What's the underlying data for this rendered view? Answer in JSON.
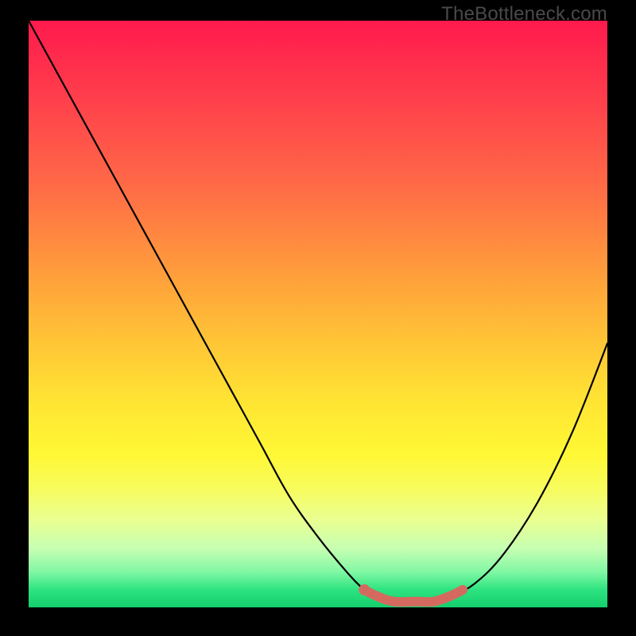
{
  "watermark": "TheBottleneck.com",
  "colors": {
    "frame": "#000000",
    "curve": "#000000",
    "highlight": "#d46a5f",
    "gradient_top": "#ff1a4d",
    "gradient_bottom": "#14cf6e"
  },
  "chart_data": {
    "type": "line",
    "title": "",
    "xlabel": "",
    "ylabel": "",
    "xlim": [
      0,
      100
    ],
    "ylim": [
      0,
      100
    ],
    "grid": false,
    "legend": false,
    "series": [
      {
        "name": "bottleneck-curve",
        "x": [
          0,
          5,
          10,
          15,
          20,
          25,
          30,
          35,
          40,
          45,
          50,
          55,
          58,
          60,
          63,
          67,
          70,
          73,
          77,
          82,
          88,
          94,
          100
        ],
        "y": [
          100,
          91,
          82,
          73,
          64,
          55,
          46,
          37,
          28,
          19,
          12,
          6,
          3,
          2,
          1,
          1,
          1,
          2,
          4,
          9,
          18,
          30,
          45
        ]
      }
    ],
    "highlight": {
      "name": "optimal-range",
      "x": [
        58,
        60,
        63,
        67,
        70,
        73,
        75
      ],
      "y": [
        3,
        2,
        1,
        1,
        1,
        2,
        3
      ]
    },
    "annotations": []
  }
}
